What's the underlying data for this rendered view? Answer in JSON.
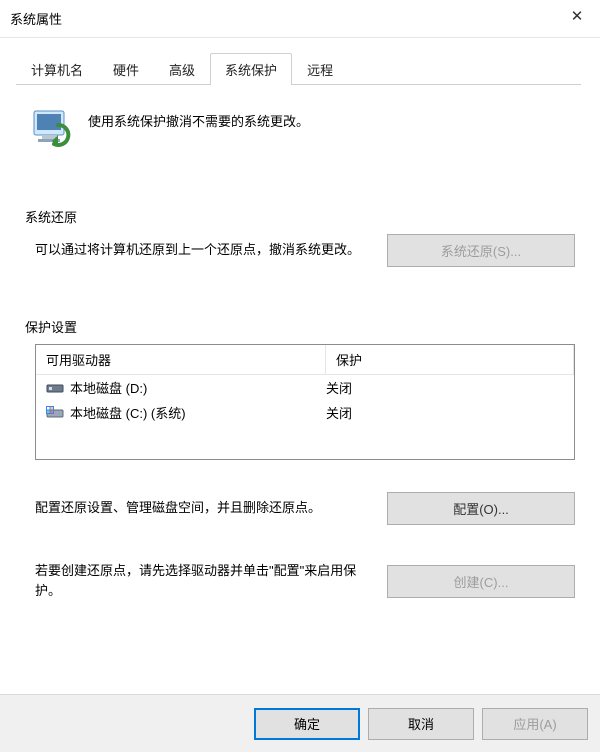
{
  "window": {
    "title": "系统属性",
    "close_glyph": "✕"
  },
  "tabs": {
    "computer_name": "计算机名",
    "hardware": "硬件",
    "advanced": "高级",
    "system_protection": "系统保护",
    "remote": "远程"
  },
  "description": "使用系统保护撤消不需要的系统更改。",
  "section_restore": {
    "label": "系统还原",
    "text": "可以通过将计算机还原到上一个还原点，撤消系统更改。",
    "button": "系统还原(S)..."
  },
  "section_settings": {
    "label": "保护设置",
    "header_drive": "可用驱动器",
    "header_protection": "保护",
    "drives": [
      {
        "name": "本地磁盘 (D:)",
        "protection": "关闭",
        "icon": "drive"
      },
      {
        "name": "本地磁盘 (C:) (系统)",
        "protection": "关闭",
        "icon": "sysdrive"
      }
    ],
    "configure_text": "配置还原设置、管理磁盘空间，并且删除还原点。",
    "configure_button": "配置(O)...",
    "create_text": "若要创建还原点，请先选择驱动器并单击\"配置\"来启用保护。",
    "create_button": "创建(C)..."
  },
  "buttons": {
    "ok": "确定",
    "cancel": "取消",
    "apply": "应用(A)"
  }
}
